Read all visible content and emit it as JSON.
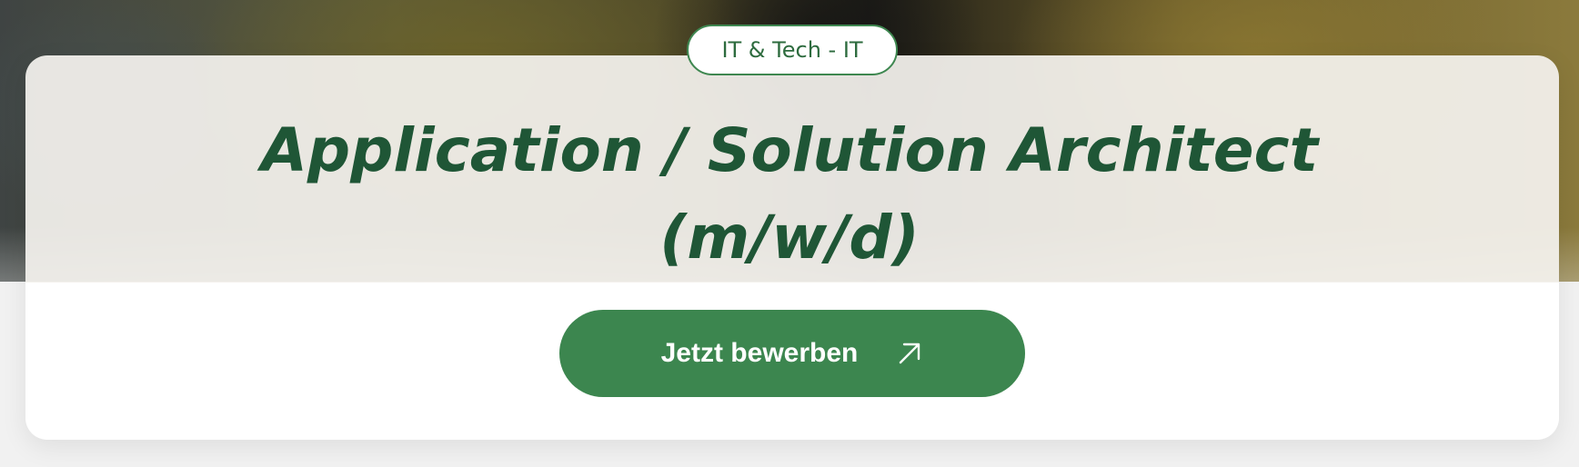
{
  "category": {
    "label": "IT & Tech - IT"
  },
  "job": {
    "title": "Application / Solution Architect (m/w/d)"
  },
  "cta": {
    "label": "Jetzt bewerben",
    "icon": "arrow-up-right-icon"
  },
  "colors": {
    "brand_green": "#3c864f",
    "title_green": "#1f5636",
    "card_background": "#ffffff"
  }
}
